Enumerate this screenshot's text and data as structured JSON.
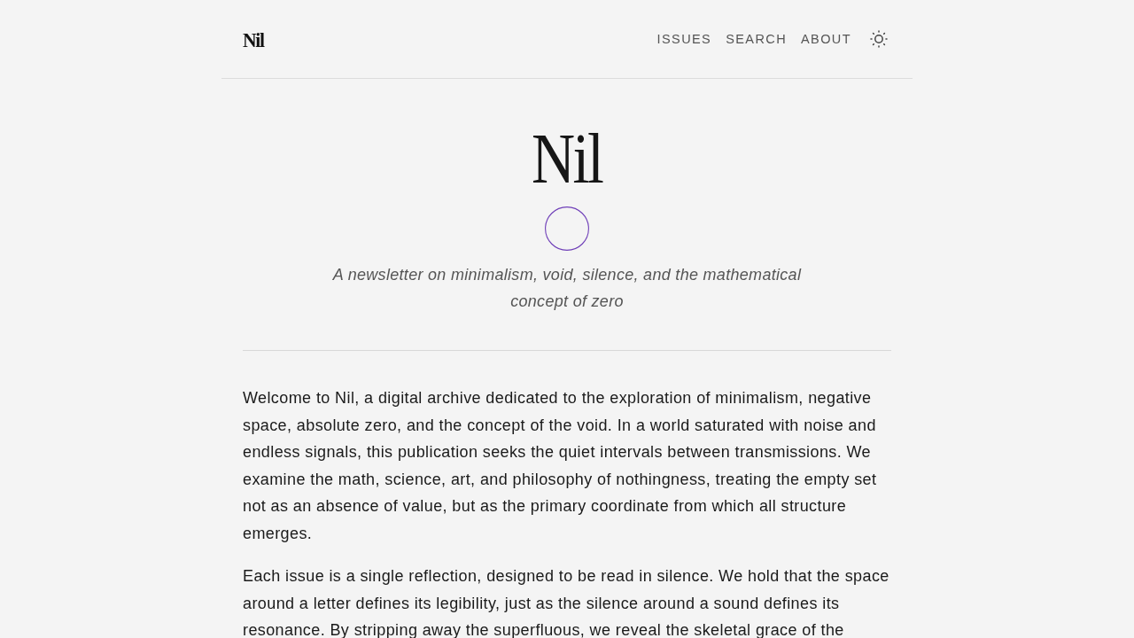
{
  "header": {
    "logo": "Nil",
    "nav": [
      {
        "label": "ISSUES"
      },
      {
        "label": "SEARCH"
      },
      {
        "label": "ABOUT"
      }
    ]
  },
  "hero": {
    "title": "Nil",
    "tagline": "A newsletter on minimalism, void, silence, and the mathematical concept of zero"
  },
  "intro": {
    "paragraphs": [
      "Welcome to Nil, a digital archive dedicated to the exploration of minimalism, negative space, absolute zero, and the concept of the void. In a world saturated with noise and endless signals, this publication seeks the quiet intervals between transmissions. We examine the math, science, art, and philosophy of nothingness, treating the empty set not as an absence of value, but as the primary coordinate from which all structure emerges.",
      "Each issue is a single reflection, designed to be read in silence. We hold that the space around a letter defines its legibility, just as the silence around a sound defines its resonance. By stripping away the superfluous, we reveal the skeletal grace of the"
    ]
  }
}
